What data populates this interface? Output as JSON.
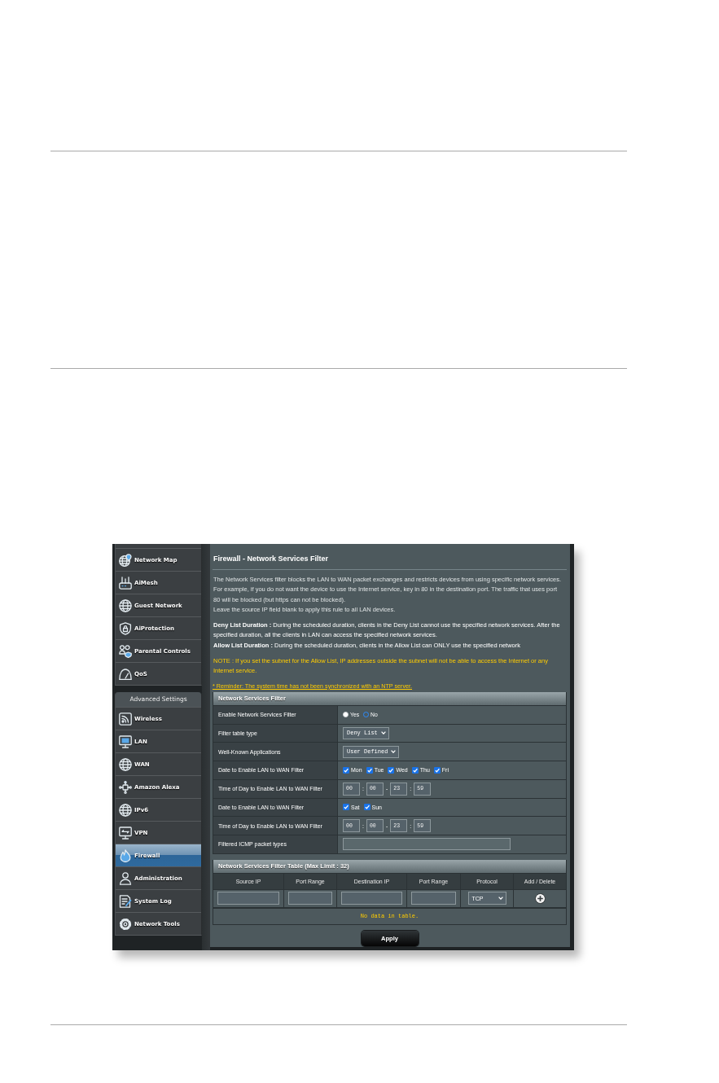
{
  "sidebar": {
    "general_items": [
      {
        "label": "Network Map",
        "selected": false
      },
      {
        "label": "AiMesh",
        "selected": false
      },
      {
        "label": "Guest Network",
        "selected": false
      },
      {
        "label": "AiProtection",
        "selected": false
      },
      {
        "label": "Parental Controls",
        "selected": false
      },
      {
        "label": "QoS",
        "selected": false
      }
    ],
    "advanced_header": "Advanced Settings",
    "advanced_items": [
      {
        "label": "Wireless",
        "selected": false
      },
      {
        "label": "LAN",
        "selected": false
      },
      {
        "label": "WAN",
        "selected": false
      },
      {
        "label": "Amazon Alexa",
        "selected": false
      },
      {
        "label": "IPv6",
        "selected": false
      },
      {
        "label": "VPN",
        "selected": false
      },
      {
        "label": "Firewall",
        "selected": true
      },
      {
        "label": "Administration",
        "selected": false
      },
      {
        "label": "System Log",
        "selected": false
      },
      {
        "label": "Network Tools",
        "selected": false
      }
    ]
  },
  "content": {
    "title": "Firewall - Network Services Filter",
    "description": [
      "The Network Services filter blocks the LAN to WAN packet exchanges and restricts devices from using specific network services. For example, if you do not want the device to use the Internet service, key in 80 in the destination port. The traffic that uses port 80 will be blocked (but https can not be blocked).",
      "Leave the source IP field blank to apply this rule to all LAN devices."
    ],
    "list_notes": [
      "**Deny List Duration :** During the scheduled duration, clients in the Deny List cannot use the specified network services. After the specified duration, all the clients in LAN can access the specified network services.",
      "**Allow List Duration :** During the scheduled duration, clients in the Allow List can ONLY use the specified network"
    ],
    "note": "NOTE : If you set the subnet for the Allow List, IP addresses outside the subnet will not be able to access the Internet or any Internet service.",
    "reminder": "* Reminder: The system time has not been synchronized with an NTP server.",
    "settings": {
      "title": "Network Services Filter",
      "rows": [
        {
          "label": "Enable Network Services Filter",
          "kind": "radio",
          "options": [
            {
              "label": "Yes",
              "selected": false
            },
            {
              "label": "No",
              "selected": true
            }
          ]
        },
        {
          "label": "Filter table type",
          "kind": "select",
          "value": "Deny List"
        },
        {
          "label": "Well-Known Applications",
          "kind": "select",
          "value": "User Defined"
        },
        {
          "label": "Date to Enable LAN to WAN Filter",
          "kind": "checkboxes",
          "options": [
            {
              "label": "Mon",
              "checked": true
            },
            {
              "label": "Tue",
              "checked": true
            },
            {
              "label": "Wed",
              "checked": true
            },
            {
              "label": "Thu",
              "checked": true
            },
            {
              "label": "Fri",
              "checked": true
            }
          ]
        },
        {
          "label": "Time of Day to Enable LAN to WAN Filter",
          "kind": "time",
          "fields": [
            "00",
            "00",
            "23",
            "59"
          ],
          "separators": [
            ":",
            "-",
            ":"
          ]
        },
        {
          "label": "Date to Enable LAN to WAN Filter",
          "kind": "checkboxes",
          "options": [
            {
              "label": "Sat",
              "checked": true
            },
            {
              "label": "Sun",
              "checked": true
            }
          ]
        },
        {
          "label": "Time of Day to Enable LAN to WAN Filter",
          "kind": "time",
          "fields": [
            "00",
            "00",
            "23",
            "59"
          ],
          "separators": [
            ":",
            "-",
            ":"
          ]
        },
        {
          "label": "Filtered ICMP packet types",
          "kind": "text"
        }
      ]
    },
    "filter_table": {
      "title": "Network Services Filter Table (Max Limit : 32)",
      "columns": [
        "Source IP",
        "Port Range",
        "Destination IP",
        "Port Range",
        "Protocol",
        "Add / Delete"
      ],
      "entry_row": [
        {
          "kind": "input"
        },
        {
          "kind": "input"
        },
        {
          "kind": "input"
        },
        {
          "kind": "input"
        },
        {
          "kind": "select",
          "value": "TCP"
        },
        {
          "kind": "add"
        }
      ],
      "empty_message": "No data in table."
    },
    "apply_button": "Apply"
  }
}
